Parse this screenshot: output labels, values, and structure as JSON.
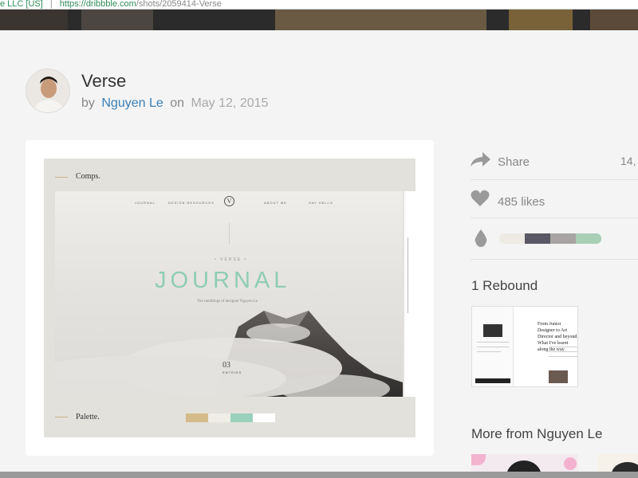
{
  "browser": {
    "company_label": "e LLC [US]",
    "url_host": "https://dribbble.com",
    "url_path": "/shots/2059414-Verse"
  },
  "shot": {
    "title": "Verse",
    "by_label": "by",
    "author": "Nguyen Le",
    "on_label": "on",
    "date": "May 12, 2015"
  },
  "artwork": {
    "comps_label": "Comps.",
    "palette_label": "Palette.",
    "nav_items": [
      "JOURNAL",
      "DESIGN RESOURCES",
      "ABOUT ME",
      "SAY HELLO"
    ],
    "logo_letter": "V",
    "kicker": "• VERSE •",
    "headline": "JOURNAL",
    "tagline": "The ramblings of designer Nguyen Le",
    "issue_number": "03",
    "issue_label": "ENTRIES",
    "palette_colors": [
      "#d4bb8a",
      "#efede6",
      "#9ad1bc",
      "#ffffff"
    ]
  },
  "sidebar": {
    "share_label": "Share",
    "views": "14,",
    "likes_label": "485 likes",
    "shot_colors": [
      "#eeebe5",
      "#5a5864",
      "#a8a4a3",
      "#a9d0b7"
    ],
    "rebounds_title": "1 Rebound",
    "rebound_headline": "From Junior Designer to Art Director and beyond. What I've learnt along the way",
    "more_title": "More from Nguyen Le"
  },
  "icons": {
    "share": "share-arrow-icon",
    "like": "heart-icon",
    "colors": "drop-icon"
  }
}
